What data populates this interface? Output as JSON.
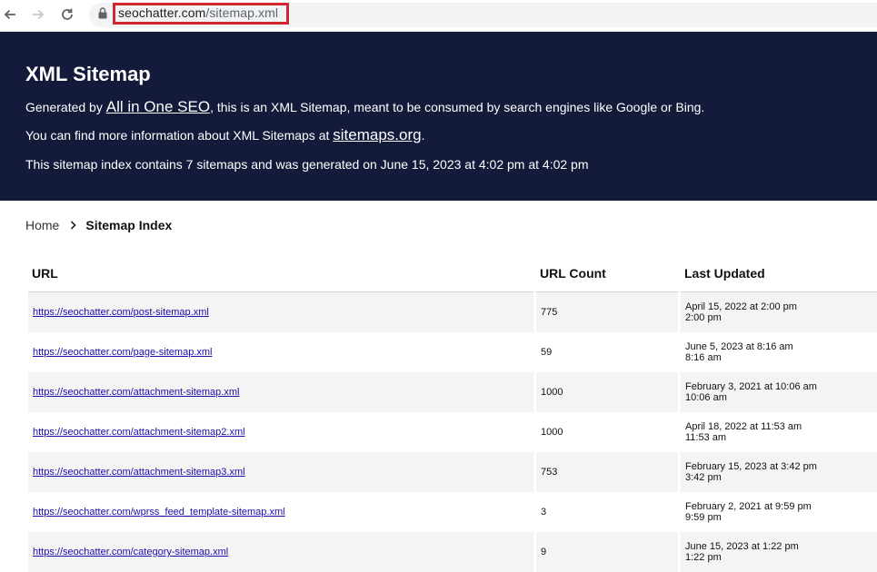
{
  "browser": {
    "url_host": "seochatter.com",
    "url_path": "/sitemap.xml"
  },
  "header": {
    "title": "XML Sitemap",
    "line1_prefix": "Generated by ",
    "line1_link": "All in One SEO",
    "line1_suffix": ", this is an XML Sitemap, meant to be consumed by search engines like Google or Bing.",
    "line2_prefix": "You can find more information about XML Sitemaps at ",
    "line2_link": "sitemaps.org",
    "line2_suffix": ".",
    "line3": "This sitemap index contains 7 sitemaps and was generated on June 15, 2023 at 4:02 pm at 4:02 pm",
    "background_color": "#141a3a"
  },
  "breadcrumb": {
    "home": "Home",
    "current": "Sitemap Index"
  },
  "table": {
    "headers": {
      "url": "URL",
      "count": "URL Count",
      "updated": "Last Updated"
    },
    "rows": [
      {
        "url": "https://seochatter.com/post-sitemap.xml",
        "count": "775",
        "updated_1": "April 15, 2022 at 2:00 pm",
        "updated_2": "2:00 pm"
      },
      {
        "url": "https://seochatter.com/page-sitemap.xml",
        "count": "59",
        "updated_1": "June 5, 2023 at 8:16 am",
        "updated_2": "8:16 am"
      },
      {
        "url": "https://seochatter.com/attachment-sitemap.xml",
        "count": "1000",
        "updated_1": "February 3, 2021 at 10:06 am",
        "updated_2": "10:06 am"
      },
      {
        "url": "https://seochatter.com/attachment-sitemap2.xml",
        "count": "1000",
        "updated_1": "April 18, 2022 at 11:53 am",
        "updated_2": "11:53 am"
      },
      {
        "url": "https://seochatter.com/attachment-sitemap3.xml",
        "count": "753",
        "updated_1": "February 15, 2023 at 3:42 pm",
        "updated_2": "3:42 pm"
      },
      {
        "url": "https://seochatter.com/wprss_feed_template-sitemap.xml",
        "count": "3",
        "updated_1": "February 2, 2021 at 9:59 pm",
        "updated_2": "9:59 pm"
      },
      {
        "url": "https://seochatter.com/category-sitemap.xml",
        "count": "9",
        "updated_1": "June 15, 2023 at 1:22 pm",
        "updated_2": "1:22 pm"
      }
    ]
  }
}
